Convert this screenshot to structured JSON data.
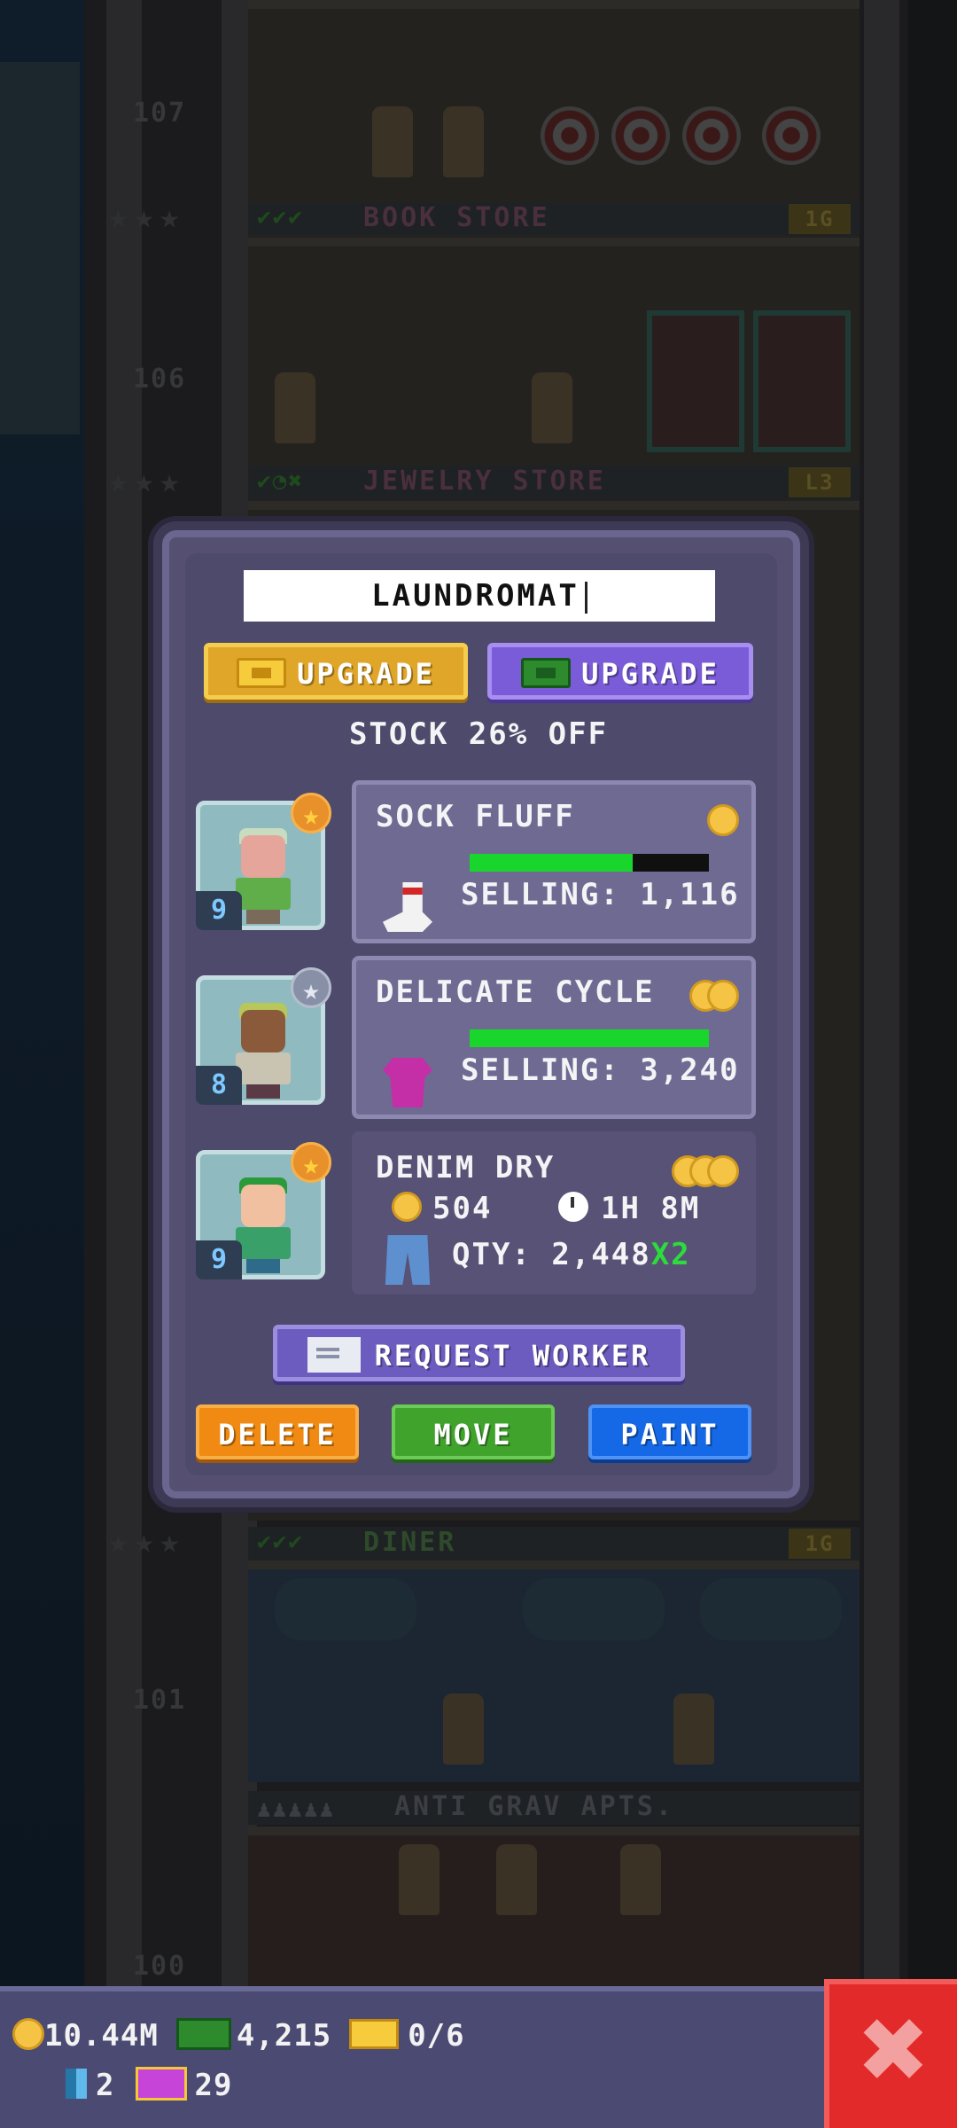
{
  "background": {
    "floors": [
      {
        "number": "107",
        "name": "BOOK STORE",
        "level": "1G",
        "stars": "★★★",
        "checks": "✔✔✔"
      },
      {
        "number": "106",
        "name": "JEWELRY STORE",
        "level": "L3",
        "stars": "★★★",
        "checks": "✔◔✖"
      },
      {
        "name": "DINER",
        "level": "1G",
        "stars": "★★★",
        "checks": "✔✔✔"
      },
      {
        "number": "101",
        "name": "ANTI GRAV APTS.",
        "residents": "♟♟♟♟♟"
      },
      {
        "number": "100"
      }
    ]
  },
  "dialog": {
    "store_name": "LAUNDROMAT",
    "upgrade_gold_label": "UPGRADE",
    "upgrade_bux_label": "UPGRADE",
    "discount_text": "STOCK 26% OFF",
    "workers": [
      {
        "level": "9",
        "star": "★",
        "star_type": "gold"
      },
      {
        "level": "8",
        "star": "★",
        "star_type": "silver"
      },
      {
        "level": "9",
        "star": "★",
        "star_type": "gold"
      }
    ],
    "products": [
      {
        "name": "SOCK FLUFF",
        "coins": 1,
        "progress": 0.68,
        "selling": "SELLING: 1,116"
      },
      {
        "name": "DELICATE CYCLE",
        "coins": 2,
        "progress": 1.0,
        "selling": "SELLING: 3,240"
      },
      {
        "name": "DENIM DRY",
        "coins": 3,
        "cost": "504",
        "time": "1H 8M",
        "qty": "QTY: 2,448",
        "multiplier": "X2"
      }
    ],
    "request_worker_label": "REQUEST WORKER",
    "delete_label": "DELETE",
    "move_label": "MOVE",
    "paint_label": "PAINT"
  },
  "hud": {
    "coins": "10.44M",
    "bux": "4,215",
    "tickets": "0/6",
    "elevator_count": "2",
    "vip_count": "29",
    "close_symbol": "✖"
  },
  "colors": {
    "dialog": "#555072",
    "gold_button": "#e0a62a",
    "bux_button": "#7a5cd8",
    "delete": "#f08a12",
    "move": "#3fa32c",
    "paint": "#1568e6",
    "close": "#e32a2a",
    "progress": "#19d62c"
  }
}
